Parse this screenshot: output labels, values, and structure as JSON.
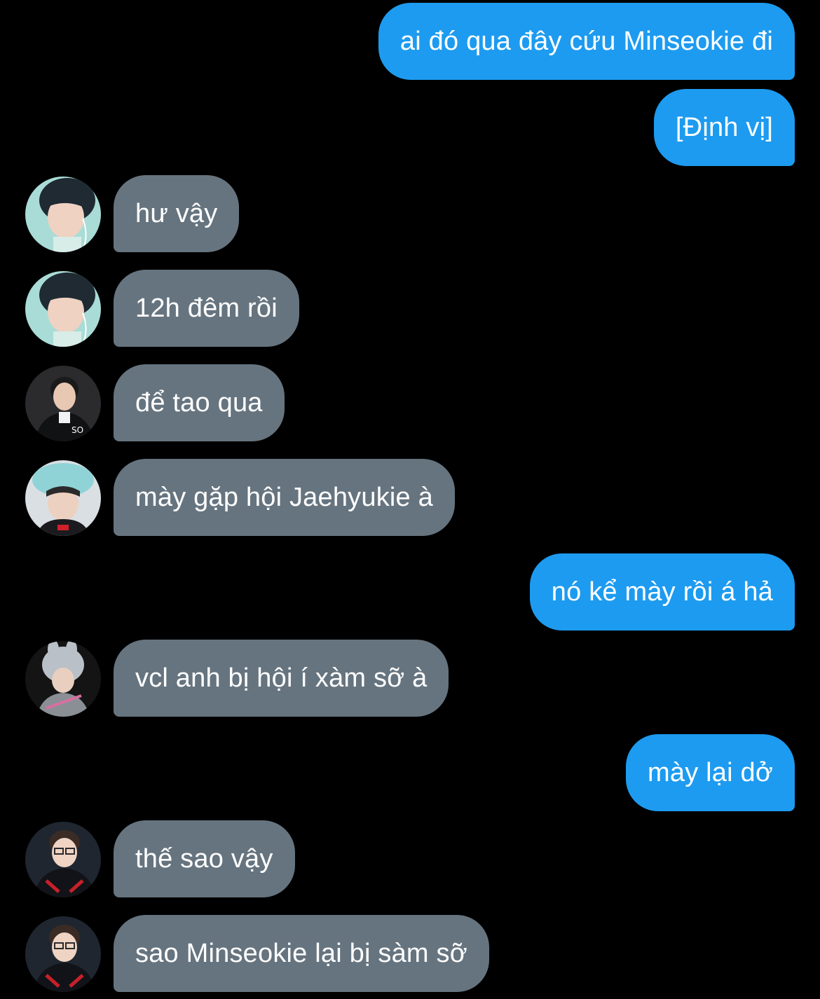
{
  "messages": [
    {
      "direction": "outgoing",
      "text": "ai đó qua đây cứu Minseokie đi"
    },
    {
      "direction": "outgoing",
      "text": "[Định vị]"
    },
    {
      "direction": "incoming",
      "avatar": "boy-earphones-avatar",
      "text": "hư vậy"
    },
    {
      "direction": "incoming",
      "avatar": "boy-earphones-avatar",
      "text": "12h đêm rồi"
    },
    {
      "direction": "incoming",
      "avatar": "black-jacket-avatar",
      "text": "để tao qua"
    },
    {
      "direction": "incoming",
      "avatar": "plush-hat-avatar",
      "text": "mày gặp hội Jaehyukie à"
    },
    {
      "direction": "outgoing",
      "text": "nó kể mày rồi á hả"
    },
    {
      "direction": "incoming",
      "avatar": "bunny-hat-avatar",
      "text": "vcl anh bị hội í xàm sỡ à"
    },
    {
      "direction": "outgoing",
      "text": "mày lại dở"
    },
    {
      "direction": "incoming",
      "avatar": "glasses-jersey-avatar",
      "text": "thế sao vậy"
    },
    {
      "direction": "incoming",
      "avatar": "glasses-jersey-avatar",
      "text": "sao Minseokie lại bị sàm sỡ"
    }
  ],
  "colors": {
    "background": "#000000",
    "outgoing_bubble": "#1d9bf0",
    "incoming_bubble": "#66747f",
    "text": "#ffffff"
  }
}
